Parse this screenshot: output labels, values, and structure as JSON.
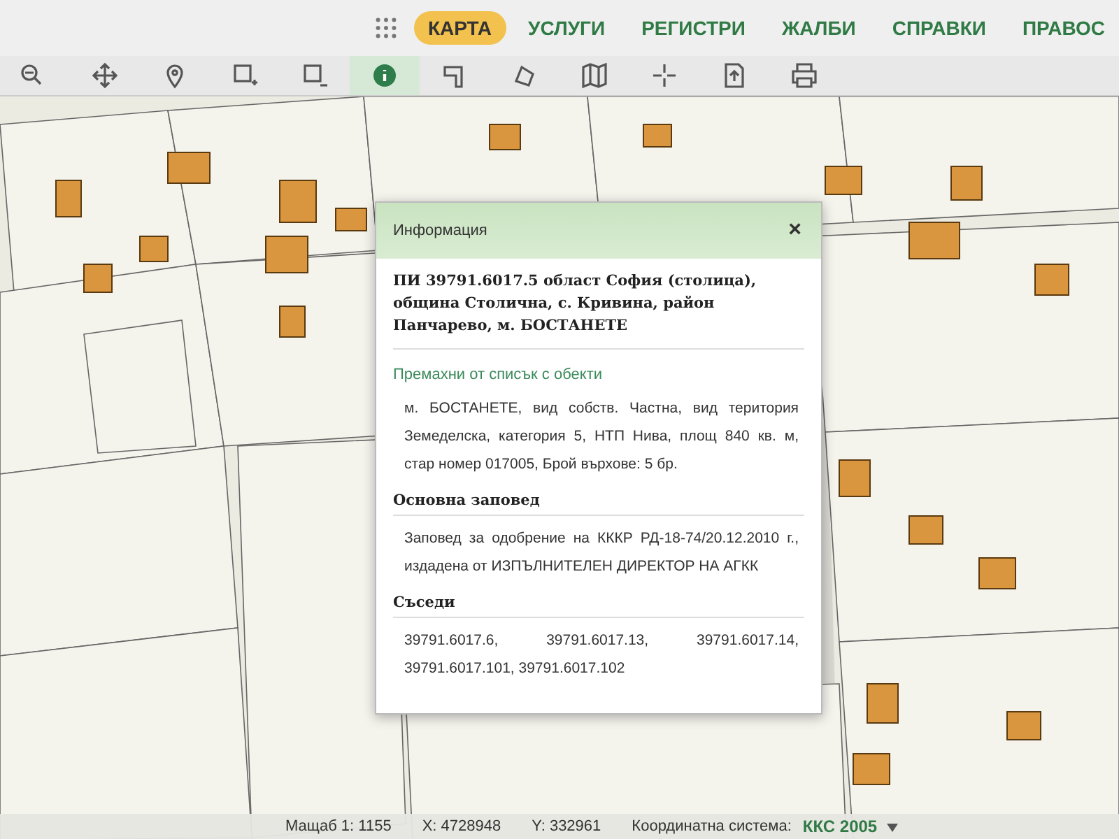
{
  "nav": {
    "items": [
      {
        "label": "КАРТА",
        "selected": true
      },
      {
        "label": "УСЛУГИ",
        "selected": false
      },
      {
        "label": "РЕГИСТРИ",
        "selected": false
      },
      {
        "label": "ЖАЛБИ",
        "selected": false
      },
      {
        "label": "СПРАВКИ",
        "selected": false
      },
      {
        "label": "ПРАВОС",
        "selected": false
      }
    ]
  },
  "toolbar": {
    "tools": [
      {
        "kind": "zoom",
        "selected": false
      },
      {
        "kind": "pan",
        "selected": false
      },
      {
        "kind": "pin",
        "selected": false
      },
      {
        "kind": "rect-add",
        "selected": false
      },
      {
        "kind": "rect-remove",
        "selected": false
      },
      {
        "kind": "info",
        "selected": true
      },
      {
        "kind": "measure",
        "selected": false
      },
      {
        "kind": "polygon",
        "selected": false
      },
      {
        "kind": "map",
        "selected": false
      },
      {
        "kind": "crosshair",
        "selected": false
      },
      {
        "kind": "export",
        "selected": false
      },
      {
        "kind": "print",
        "selected": false
      }
    ]
  },
  "popup": {
    "title": "Информация",
    "close": "×",
    "heading": "ПИ 39791.6017.5 област София (столица), община Столична, с. Кривина, район Панчарево, м. БОСТАНЕТЕ",
    "link": "Премахни от списък с обекти",
    "description": "м. БОСТАНЕТЕ, вид собств. Частна, вид територия Земеделска, категория 5, НТП Нива, площ 840 кв. м, стар номер 017005, Брой върхове: 5 бр.",
    "sections": [
      {
        "title": "Основна заповед",
        "text": "Заповед за одобрение на КККР РД-18-74/20.12.2010 г., издадена от ИЗПЪЛНИТЕЛЕН ДИРЕКТОР НА АГКК"
      },
      {
        "title": "Съседи",
        "text": "39791.6017.6, 39791.6017.13, 39791.6017.14, 39791.6017.101, 39791.6017.102"
      }
    ]
  },
  "status_bar": {
    "scale": "Мащаб 1: 1155",
    "x": "X: 4728948",
    "y": "Y: 332961",
    "crs_label": "Координатна система:",
    "crs": "ККС 2005"
  }
}
